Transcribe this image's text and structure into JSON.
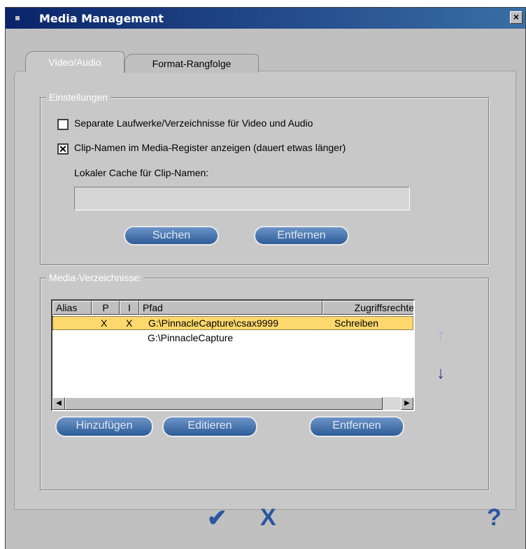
{
  "window": {
    "title": "Media Management",
    "close_glyph": "×"
  },
  "tabs": [
    {
      "label": "Video/Audio",
      "active": true
    },
    {
      "label": "Format-Rangfolge",
      "active": false
    }
  ],
  "settings": {
    "legend": "Einstellungen",
    "separate_drives": {
      "label": "Separate Laufwerke/Verzeichnisse für Video und Audio",
      "checked": false,
      "glyph": ""
    },
    "clip_names": {
      "label": "Clip-Namen im Media-Register anzeigen (dauert etwas länger)",
      "checked": true,
      "glyph": "✕"
    },
    "cache_label": "Lokaler Cache für Clip-Namen:",
    "cache_value": "",
    "search_button": "Suchen",
    "remove_button": "Entfernen"
  },
  "media_dirs": {
    "legend": "Media-Verzeichnisse:",
    "columns": [
      "Alias",
      "P",
      "I",
      "Pfad",
      "Zugriffsrechte"
    ],
    "rows": [
      {
        "alias": "",
        "p": "X",
        "i": "X",
        "path": "G:\\PinnacleCapture\\csax9999",
        "access": "Schreiben",
        "selected": true
      },
      {
        "alias": "",
        "p": "",
        "i": "",
        "path": "G:\\PinnacleCapture",
        "access": "",
        "selected": false
      }
    ],
    "add_button": "Hinzufügen",
    "edit_button": "Editieren",
    "remove_button": "Entfernen"
  },
  "footer": {
    "ok_glyph": "✔",
    "cancel_glyph": "X",
    "help_glyph": "?"
  },
  "colors": {
    "selection": "#fdd86c",
    "button_blue": "#2e5c98",
    "titlebar": "#0a246a"
  }
}
